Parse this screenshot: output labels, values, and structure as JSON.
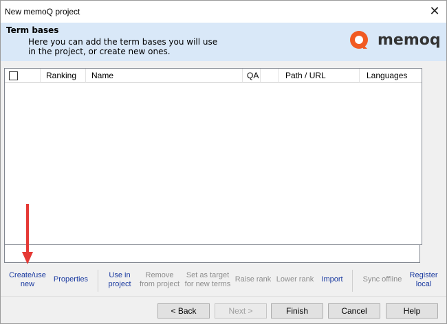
{
  "window": {
    "title": "New memoQ project",
    "close_glyph": "✕"
  },
  "header": {
    "title": "Term bases",
    "description": "Here you can add the term bases you will use in the project, or create new ones.",
    "logo_text": "memoq",
    "brand_color": "#f15a22"
  },
  "table": {
    "columns": {
      "ranking": "Ranking",
      "name": "Name",
      "qa": "QA",
      "path": "Path / URL",
      "languages": "Languages"
    },
    "rows": []
  },
  "toolbar": {
    "create_use_new": "Create/use new",
    "properties": "Properties",
    "use_in_project": "Use in project",
    "remove_from_project": "Remove from project",
    "set_as_target": "Set as target for new terms",
    "raise_rank": "Raise rank",
    "lower_rank": "Lower rank",
    "import": "Import",
    "sync_offline": "Sync offline",
    "register_local": "Register local"
  },
  "footer": {
    "back": "< Back",
    "next": "Next >",
    "finish": "Finish",
    "cancel": "Cancel",
    "help": "Help"
  }
}
